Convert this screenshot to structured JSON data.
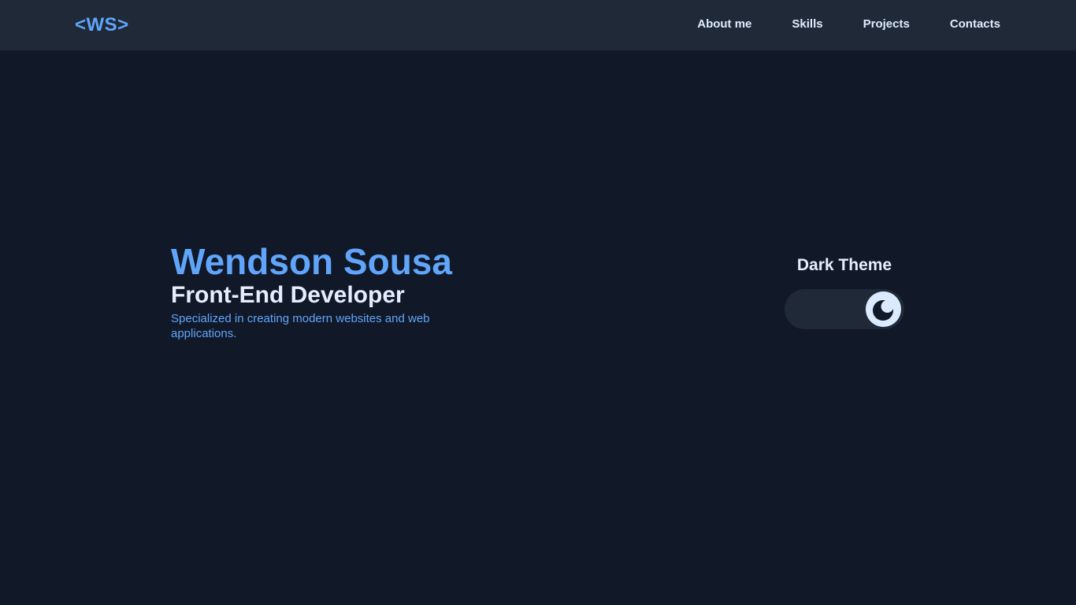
{
  "nav": {
    "logo": "<WS>",
    "links": [
      "About me",
      "Skills",
      "Projects",
      "Contacts"
    ]
  },
  "hero": {
    "name": "Wendson Sousa",
    "role": "Front-End Developer",
    "description": "Specialized in creating modern websites and web applications."
  },
  "theme": {
    "label": "Dark Theme",
    "toggle_state": "dark",
    "toggle_icon": "moon-icon"
  },
  "colors": {
    "page_background": "#111827",
    "navbar_background": "#1f2937",
    "accent": "#60a5fa",
    "text_light": "#e5eeff",
    "toggle_track": "#1f2937",
    "toggle_knob": "#dbeafe"
  }
}
